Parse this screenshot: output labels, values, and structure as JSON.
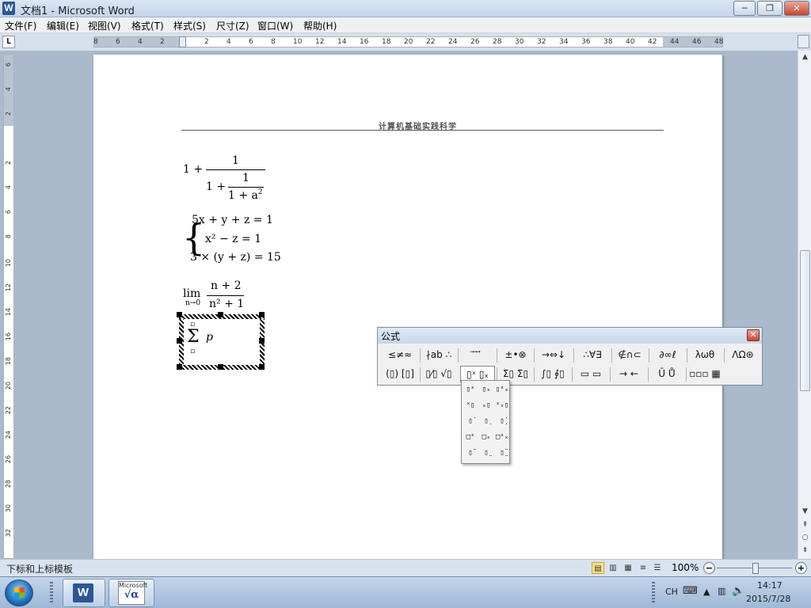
{
  "window": {
    "title": "文档1 - Microsoft Word",
    "app_icon": "W",
    "minimize": "─",
    "restore": "❐",
    "close": "✕"
  },
  "menu": [
    {
      "label": "文件(F)"
    },
    {
      "label": "编辑(E)"
    },
    {
      "label": "视图(V)"
    },
    {
      "label": "格式(T)"
    },
    {
      "label": "样式(S)"
    },
    {
      "label": "尺寸(Z)"
    },
    {
      "label": "窗口(W)"
    },
    {
      "label": "帮助(H)"
    }
  ],
  "ruler": {
    "tab_selector": "L",
    "ticks": [
      "8",
      "6",
      "4",
      "2",
      "",
      "2",
      "4",
      "6",
      "8",
      "10",
      "12",
      "14",
      "16",
      "18",
      "20",
      "22",
      "24",
      "26",
      "28",
      "30",
      "32",
      "34",
      "36",
      "38",
      "40",
      "42",
      "44",
      "46",
      "48"
    ],
    "vticks": [
      "6",
      "4",
      "2",
      "",
      "2",
      "4",
      "6",
      "8",
      "10",
      "12",
      "14",
      "16",
      "18",
      "20",
      "22",
      "24",
      "26",
      "28",
      "30",
      "32"
    ]
  },
  "document": {
    "header": "计算机基础实践科学",
    "eq1": {
      "lead": "1 +",
      "num": "1",
      "den_lead": "1 +",
      "inner_num": "1",
      "inner_den": "1 + a",
      "sup": "2"
    },
    "eq2": {
      "row1": "5x + y + z  = 1",
      "row2": "x² − z  = 1",
      "row3": "3 × (y + z) = 15"
    },
    "eq3": {
      "lim": "lim",
      "sub": "n→0",
      "num": "n + 2",
      "den": "n² + 1"
    },
    "eq4": {
      "sum": "Σ",
      "var": "p"
    }
  },
  "equation_toolbar": {
    "title": "公式",
    "close": "✕",
    "row1": [
      "≤≠≈",
      "∤ab ∴",
      "⃗ ⃗ ⃗",
      "±•⊗",
      "→⇔↓",
      "∴∀∃",
      "∉∩⊂",
      "∂∞ℓ",
      "λωθ",
      "ΛΩ⊛"
    ],
    "row2": [
      "(▯) [▯]",
      "▯⁄▯ √▯",
      "▯ˣ ▯ₓ",
      "Σ▯ Σ▯",
      "∫▯ ∮▯",
      "▭ ▭",
      "→ ←",
      "Ū Ů",
      "▫▫▫ ▦"
    ]
  },
  "template_dropdown": {
    "items": [
      "▯ˣ",
      "▯ₓ",
      "▯ˣₓ",
      "ˣ▯",
      "ₓ▯",
      "ˣₓ▯",
      "▯̇",
      "▯̣",
      "▯̣̇",
      "□ˣ",
      "□ₓ",
      "□ˣₓ",
      "▯̈",
      "▯̤",
      "▯̤̈"
    ]
  },
  "status": {
    "left": "下标和上标模板",
    "zoom": "100%",
    "minus": "−",
    "plus": "+"
  },
  "taskbar": {
    "lang": "CH",
    "time": "14:17",
    "date": "2015/7/28",
    "eq_label": "Microsoft",
    "eq_symbol": "√α"
  },
  "colors": {
    "titlebar": "#c3d4ea",
    "page": "#ffffff",
    "workspace": "#abb9cc",
    "close_red": "#c7442b"
  }
}
